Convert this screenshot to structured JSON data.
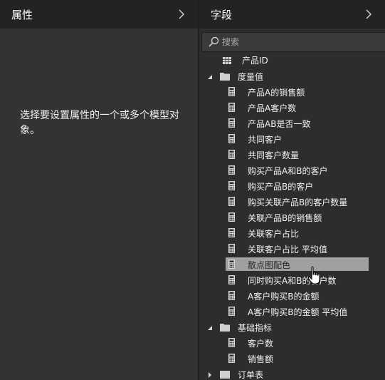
{
  "properties_pane": {
    "title": "属性",
    "message": "选择要设置属性的一个或多个模型对象。"
  },
  "fields_pane": {
    "title": "字段",
    "search": {
      "placeholder": "搜索",
      "value": ""
    },
    "partial_top_item": "产品ID",
    "measure_folder": {
      "label": "度量值",
      "expanded": true,
      "items": [
        "产品A的销售额",
        "产品A客户数",
        "产品AB是否一致",
        "共同客户",
        "共同客户数量",
        "购买产品A和B的客户",
        "购买产品B的客户",
        "购买关联产品B的客户数量",
        "关联产品B的销售额",
        "关联客户占比",
        "关联客户占比 平均值",
        "散点图配色",
        "同时购买A和B的客户数",
        "A客户购买B的金额",
        "A客户购买B的金额 平均值"
      ],
      "selected_item": "散点图配色"
    },
    "basic_folder": {
      "label": "基础指标",
      "expanded": true,
      "items": [
        "客户数",
        "销售额"
      ]
    },
    "partial_bottom_item": "订单表"
  },
  "colors": {
    "header_bg": "#232323",
    "pane_bg": "#333333",
    "selection": "#a0a0a0"
  }
}
